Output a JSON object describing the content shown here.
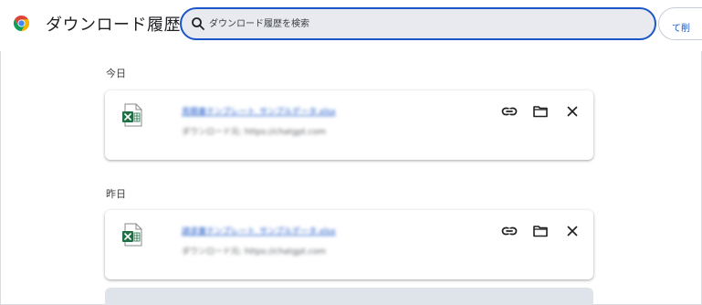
{
  "header": {
    "title": "ダウンロード履歴",
    "search_placeholder": "ダウンロード履歴を検索",
    "clear_all_label": "て削"
  },
  "sections": [
    {
      "label": "今日",
      "items": [
        {
          "file_name": "見積書テンプレート_サンプルデータ.xlsx",
          "source": "ダウンロード元: https://chatgpt.com",
          "icon": "excel-file-icon"
        }
      ]
    },
    {
      "label": "昨日",
      "items": [
        {
          "file_name": "請求書テンプレート_サンプルデータ.xlsx",
          "source": "ダウンロード元: https://chatgpt.com",
          "icon": "excel-file-icon"
        }
      ]
    }
  ],
  "actions": {
    "copy_link_icon": "link-icon",
    "show_in_folder_icon": "folder-icon",
    "remove_icon": "close-icon"
  },
  "colors": {
    "accent": "#1a56c8",
    "search_bg": "#e8eaf0",
    "excel_green": "#1e7145"
  }
}
